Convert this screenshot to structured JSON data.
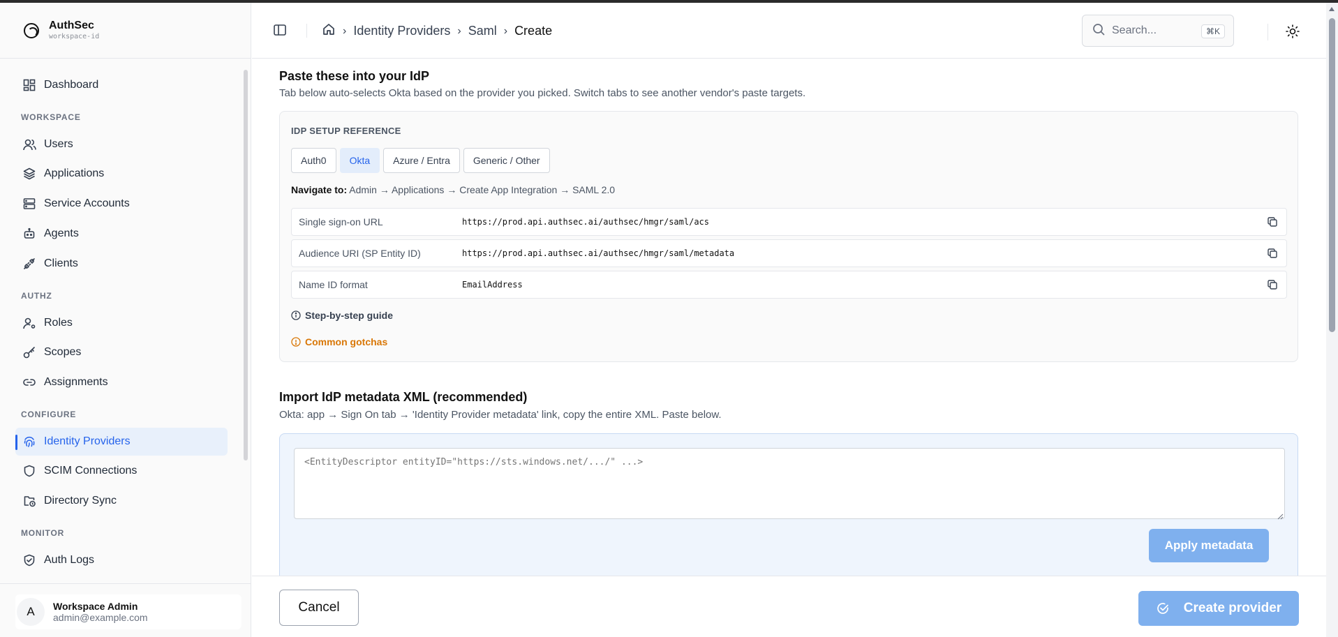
{
  "brand": {
    "name": "AuthSec",
    "workspace": "workspace-id"
  },
  "sidebar": {
    "dashboard": "Dashboard",
    "sections": {
      "workspace": "WORKSPACE",
      "authz": "AUTHZ",
      "configure": "CONFIGURE",
      "monitor": "MONITOR"
    },
    "items": {
      "users": "Users",
      "applications": "Applications",
      "service_accounts": "Service Accounts",
      "agents": "Agents",
      "clients": "Clients",
      "roles": "Roles",
      "scopes": "Scopes",
      "assignments": "Assignments",
      "identity_providers": "Identity Providers",
      "scim_connections": "SCIM Connections",
      "directory_sync": "Directory Sync",
      "auth_logs": "Auth Logs"
    },
    "active_item": "Identity Providers"
  },
  "user": {
    "initial": "A",
    "name": "Workspace Admin",
    "email": "admin@example.com"
  },
  "header": {
    "breadcrumbs": [
      "Identity Providers",
      "Saml",
      "Create"
    ],
    "search_placeholder": "Search...",
    "search_shortcut": "⌘K"
  },
  "paste_section": {
    "title": "Paste these into your IdP",
    "description": "Tab below auto-selects Okta based on the provider you picked. Switch tabs to see another vendor's paste targets.",
    "reference_heading": "IDP SETUP REFERENCE",
    "tabs": [
      "Auth0",
      "Okta",
      "Azure / Entra",
      "Generic / Other"
    ],
    "active_tab": "Okta",
    "navigate_label": "Navigate to:",
    "navigate_path": "Admin → Applications → Create App Integration → SAML 2.0",
    "fields": [
      {
        "label": "Single sign-on URL",
        "value": "https://prod.api.authsec.ai/authsec/hmgr/saml/acs"
      },
      {
        "label": "Audience URI (SP Entity ID)",
        "value": "https://prod.api.authsec.ai/authsec/hmgr/saml/metadata"
      },
      {
        "label": "Name ID format",
        "value": "EmailAddress"
      }
    ],
    "guide_label": "Step-by-step guide",
    "gotchas_label": "Common gotchas"
  },
  "import_section": {
    "title": "Import IdP metadata XML (recommended)",
    "description": "Okta: app → Sign On tab → 'Identity Provider metadata' link, copy the entire XML. Paste below.",
    "xml_placeholder": "<EntityDescriptor entityID=\"https://sts.windows.net/.../\" ...>",
    "apply_label": "Apply metadata"
  },
  "footer": {
    "cancel_label": "Cancel",
    "create_label": "Create provider"
  },
  "colors": {
    "accent": "#2563eb",
    "warning": "#d97706",
    "disabled_button": "#7fb0ee"
  }
}
